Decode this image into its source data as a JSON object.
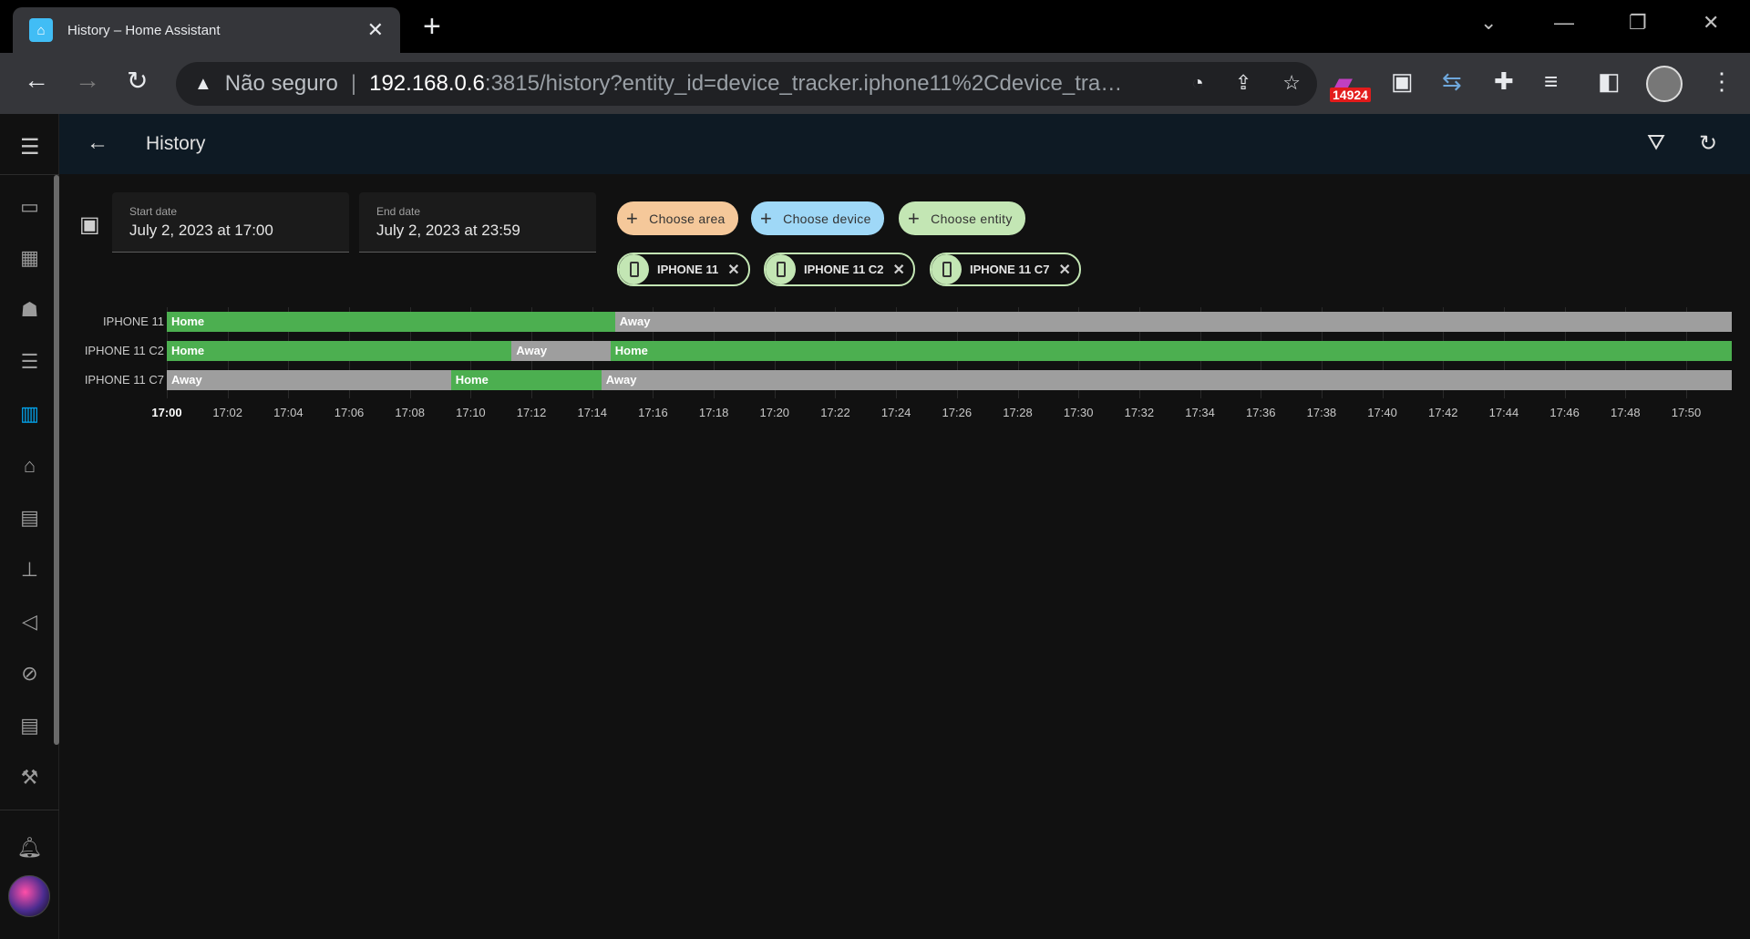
{
  "browser": {
    "tab_title": "History – Home Assistant",
    "not_secure": "Não seguro",
    "url_host": "192.168.0.6",
    "url_rest": ":3815/history?entity_id=device_tracker.iphone11%2Cdevice_track...",
    "ext_badge": "14924"
  },
  "header": {
    "title": "History"
  },
  "sidebar": {
    "items": [
      "monitor-icon",
      "dashboard-icon",
      "robot-icon",
      "list-icon",
      "history-icon",
      "home-wifi-icon",
      "chip-icon",
      "hierarchy-icon",
      "vscode-icon",
      "compass-icon",
      "chip2-icon",
      "hammer-icon"
    ],
    "active_index": 4
  },
  "dates": {
    "start_label": "Start date",
    "start_value": "July 2, 2023 at 17:00",
    "end_label": "End date",
    "end_value": "July 2, 2023 at 23:59"
  },
  "pickers": {
    "area": "Choose area",
    "device": "Choose device",
    "entity": "Choose entity"
  },
  "selected_entities": [
    "IPHONE 11",
    "IPHONE 11 C2",
    "IPHONE 11 C7"
  ],
  "colors": {
    "home": "#4caf50",
    "away": "#9e9e9e",
    "area_chip": "#f5c89a",
    "device_chip": "#9fd8f7",
    "entity_chip": "#c3e6b4",
    "accent": "#03a9f4"
  },
  "chart_data": {
    "type": "timeline",
    "x_start": "17:00",
    "x_end": "17:51.5",
    "ticks": [
      "17:00",
      "17:02",
      "17:04",
      "17:06",
      "17:08",
      "17:10",
      "17:12",
      "17:14",
      "17:16",
      "17:18",
      "17:20",
      "17:22",
      "17:24",
      "17:26",
      "17:28",
      "17:30",
      "17:32",
      "17:34",
      "17:36",
      "17:38",
      "17:40",
      "17:42",
      "17:44",
      "17:46",
      "17:48",
      "17:50"
    ],
    "rows": [
      {
        "name": "IPHONE 11",
        "segments": [
          {
            "state": "Home",
            "start": 0,
            "end": 14.75
          },
          {
            "state": "Away",
            "start": 14.75,
            "end": 51.5
          }
        ]
      },
      {
        "name": "IPHONE 11 C2",
        "segments": [
          {
            "state": "Home",
            "start": 0,
            "end": 11.35
          },
          {
            "state": "Away",
            "start": 11.35,
            "end": 14.6
          },
          {
            "state": "Home",
            "start": 14.6,
            "end": 51.5
          }
        ]
      },
      {
        "name": "IPHONE 11 C7",
        "segments": [
          {
            "state": "Away",
            "start": 0,
            "end": 9.35
          },
          {
            "state": "Home",
            "start": 9.35,
            "end": 14.3
          },
          {
            "state": "Away",
            "start": 14.3,
            "end": 51.5
          }
        ]
      }
    ]
  }
}
